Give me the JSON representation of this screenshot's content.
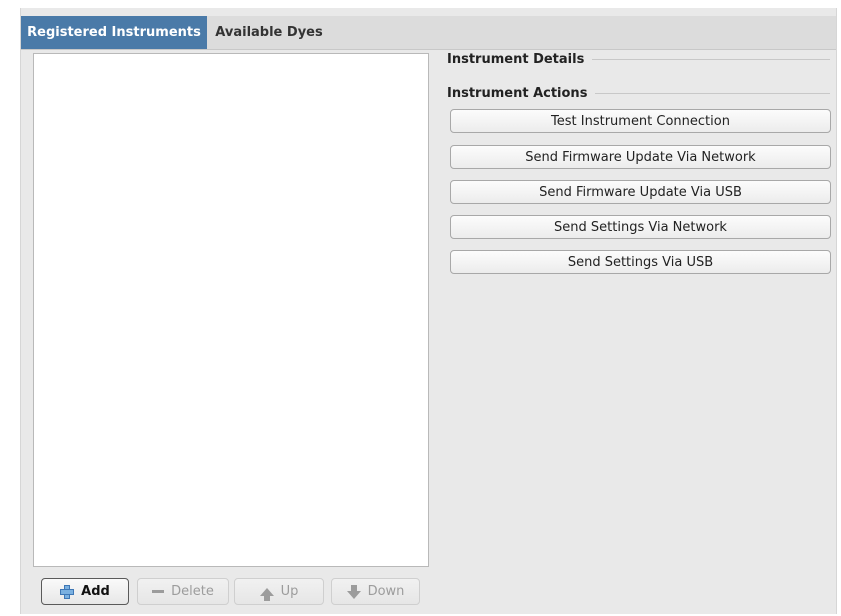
{
  "tabs": [
    {
      "label": "Registered Instruments",
      "active": true
    },
    {
      "label": "Available Dyes",
      "active": false
    }
  ],
  "sections": {
    "details_title": "Instrument Details",
    "actions_title": "Instrument Actions"
  },
  "actions": [
    {
      "label": "Test Instrument Connection"
    },
    {
      "label": "Send Firmware Update Via Network"
    },
    {
      "label": "Send Firmware Update Via USB"
    },
    {
      "label": "Send Settings Via Network"
    },
    {
      "label": "Send Settings Via USB"
    }
  ],
  "list_buttons": {
    "add": {
      "label": "Add",
      "icon": "plus-icon"
    },
    "delete": {
      "label": "Delete",
      "icon": "minus-icon"
    },
    "up": {
      "label": "Up",
      "icon": "up-arrow-icon"
    },
    "down": {
      "label": "Down",
      "icon": "down-arrow-icon"
    }
  },
  "colors": {
    "active_tab": "#4a7aa8",
    "panel_bg": "#e9e9e9"
  }
}
